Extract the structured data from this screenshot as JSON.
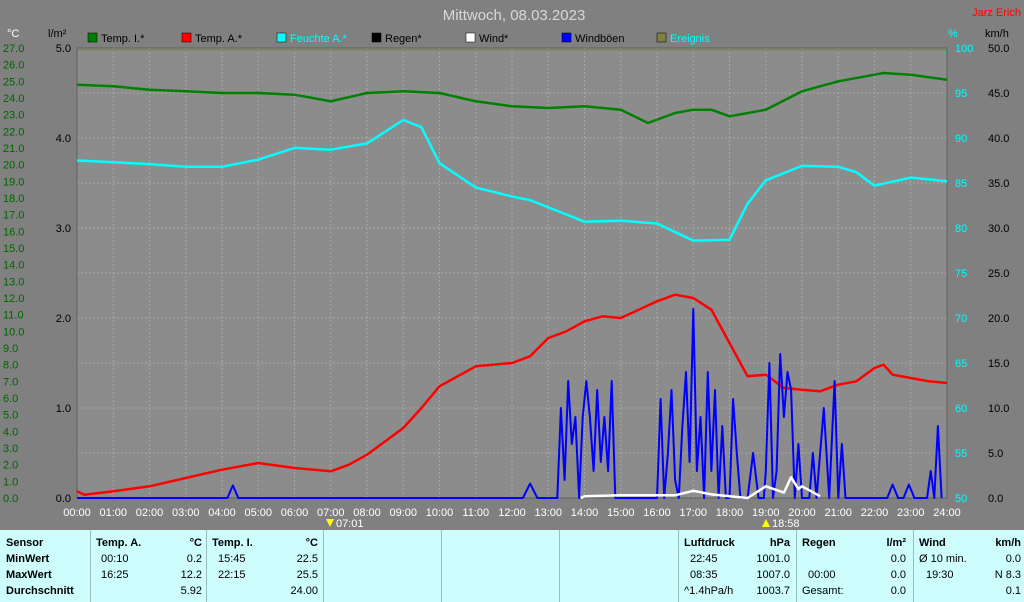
{
  "header": {
    "title": "Mittwoch, 08.03.2023",
    "author": "Jarz Erich"
  },
  "axes": {
    "left_unit_temp": "°C",
    "left_unit_rain": "l/m²",
    "right_unit_pct": "%",
    "right_unit_wind": "km/h"
  },
  "legend": [
    {
      "label": "Temp. I.*",
      "color": "#008000"
    },
    {
      "label": "Temp. A.*",
      "color": "#ff0000"
    },
    {
      "label": "Feuchte A.*",
      "color": "#00ffff"
    },
    {
      "label": "Regen*",
      "color": "#000000"
    },
    {
      "label": "Wind*",
      "color": "#ffffff"
    },
    {
      "label": "Windböen",
      "color": "#0000ff"
    },
    {
      "label": "Ereignis",
      "color": "#808040"
    }
  ],
  "markers": {
    "sunrise": "07:01",
    "sunset": "18:58"
  },
  "chart_data": {
    "type": "line",
    "title": "Mittwoch, 08.03.2023",
    "xlabels": [
      "00:00",
      "01:00",
      "02:00",
      "03:00",
      "04:00",
      "05:00",
      "06:00",
      "07:00",
      "08:00",
      "09:00",
      "10:00",
      "11:00",
      "12:00",
      "13:00",
      "14:00",
      "15:00",
      "16:00",
      "17:00",
      "18:00",
      "19:00",
      "20:00",
      "21:00",
      "22:00",
      "23:00",
      "24:00"
    ],
    "y_temp": {
      "range": [
        0,
        27
      ],
      "ticks": [
        "0.0",
        "1.0",
        "2.0",
        "3.0",
        "4.0",
        "5.0",
        "6.0",
        "7.0",
        "8.0",
        "9.0",
        "10.0",
        "11.0",
        "12.0",
        "13.0",
        "14.0",
        "15.0",
        "16.0",
        "17.0",
        "18.0",
        "19.0",
        "20.0",
        "21.0",
        "22.0",
        "23.0",
        "24.0",
        "25.0",
        "26.0",
        "27.0"
      ]
    },
    "y_rain": {
      "range": [
        0,
        5
      ],
      "ticks": [
        "0.0",
        "1.0",
        "2.0",
        "3.0",
        "4.0",
        "5.0"
      ]
    },
    "y_pct": {
      "range": [
        50,
        100
      ],
      "ticks": [
        "50",
        "55",
        "60",
        "65",
        "70",
        "75",
        "80",
        "85",
        "90",
        "95",
        "100"
      ]
    },
    "y_wind": {
      "range": [
        0,
        50
      ],
      "ticks": [
        "0.0",
        "5.0",
        "10.0",
        "15.0",
        "20.0",
        "25.0",
        "30.0",
        "35.0",
        "40.0",
        "45.0",
        "50.0"
      ]
    },
    "grid": true,
    "series": [
      {
        "name": "Temp. I.*",
        "axis": "temp",
        "color": "#008000",
        "x": [
          0,
          1,
          2,
          3,
          4,
          5,
          6,
          7,
          8,
          9,
          10,
          11,
          12,
          13,
          14,
          15,
          15.75,
          16.5,
          17,
          17.5,
          18,
          19,
          20,
          21,
          22,
          22.25,
          23,
          24
        ],
        "y": [
          24.8,
          24.7,
          24.5,
          24.4,
          24.3,
          24.3,
          24.2,
          23.8,
          24.3,
          24.4,
          24.3,
          23.8,
          23.5,
          23.4,
          23.5,
          23.3,
          22.5,
          23.1,
          23.3,
          23.3,
          22.9,
          23.3,
          24.4,
          25.0,
          25.4,
          25.5,
          25.4,
          25.1
        ]
      },
      {
        "name": "Temp. A.*",
        "axis": "temp",
        "color": "#ff0000",
        "x": [
          0,
          0.2,
          1,
          2,
          3,
          4,
          5,
          6,
          7,
          7.5,
          8,
          9,
          9.5,
          10,
          11,
          12,
          12.5,
          13,
          13.5,
          14,
          14.5,
          15,
          16,
          16.5,
          17,
          17.5,
          18,
          18.5,
          19,
          19.5,
          20,
          20.5,
          21,
          21.5,
          22,
          22.25,
          22.5,
          23,
          23.5,
          24
        ],
        "y": [
          0.4,
          0.2,
          0.4,
          0.7,
          1.2,
          1.7,
          2.1,
          1.8,
          1.6,
          2.0,
          2.6,
          4.2,
          5.4,
          6.7,
          7.9,
          8.1,
          8.5,
          9.6,
          10.0,
          10.6,
          10.9,
          10.8,
          11.8,
          12.2,
          12.0,
          11.3,
          9.3,
          7.3,
          7.4,
          6.6,
          6.5,
          6.4,
          6.8,
          7.0,
          7.8,
          8.0,
          7.4,
          7.2,
          7.0,
          6.9
        ]
      },
      {
        "name": "Feuchte A.*",
        "axis": "pct",
        "color": "#00ffff",
        "x": [
          0,
          1,
          2,
          3,
          4,
          5,
          6,
          7,
          8,
          9,
          9.5,
          10,
          11,
          12,
          12.5,
          13,
          14,
          15,
          16,
          17,
          18,
          18.5,
          19,
          20,
          21,
          21.5,
          22,
          23,
          24
        ],
        "y": [
          87.5,
          87.3,
          87.1,
          86.8,
          86.8,
          87.6,
          88.9,
          88.7,
          89.4,
          92.0,
          91.2,
          87.2,
          84.5,
          83.5,
          83.1,
          82.3,
          80.7,
          80.8,
          80.5,
          78.6,
          78.7,
          82.7,
          85.3,
          86.9,
          86.8,
          86.2,
          84.7,
          85.6,
          85.2
        ]
      },
      {
        "name": "Windböen",
        "axis": "wind",
        "color": "#0000ff",
        "x": [
          0,
          4.15,
          4.3,
          4.45,
          12.3,
          12.5,
          12.7,
          13.25,
          13.35,
          13.45,
          13.55,
          13.65,
          13.75,
          13.85,
          13.95,
          14.05,
          14.15,
          14.25,
          14.35,
          14.45,
          14.55,
          14.65,
          14.75,
          14.85,
          15.5,
          16.0,
          16.1,
          16.2,
          16.3,
          16.4,
          16.5,
          16.6,
          16.7,
          16.8,
          16.9,
          17.0,
          17.1,
          17.2,
          17.3,
          17.4,
          17.5,
          17.6,
          17.7,
          17.8,
          17.9,
          18.0,
          18.1,
          18.2,
          18.3,
          18.5,
          18.65,
          18.8,
          18.95,
          19.0,
          19.1,
          19.2,
          19.3,
          19.4,
          19.5,
          19.6,
          19.7,
          19.8,
          19.9,
          20.0,
          20.2,
          20.3,
          20.4,
          20.6,
          20.75,
          20.9,
          21.0,
          21.1,
          21.2,
          21.3,
          22.35,
          22.5,
          22.65,
          22.8,
          22.95,
          23.1,
          23.45,
          23.55,
          23.65,
          23.75,
          23.85
        ],
        "y": [
          0,
          0,
          1.4,
          0,
          0,
          1.6,
          0,
          0,
          10,
          2,
          13,
          6,
          9,
          0,
          9,
          13,
          9,
          3,
          12,
          4,
          9,
          3,
          13,
          0,
          0,
          0,
          11,
          0,
          5,
          12,
          2,
          0,
          8,
          14,
          4,
          21,
          3,
          9,
          0,
          14,
          3,
          12,
          0,
          8,
          0,
          0,
          11,
          5,
          0,
          0,
          5,
          0,
          0,
          3,
          15,
          0,
          3,
          16,
          9,
          14,
          12,
          0,
          6,
          0,
          0,
          5,
          0,
          10,
          0,
          13,
          0,
          6,
          0,
          0,
          0,
          1.5,
          0,
          0,
          1.5,
          0,
          0,
          3,
          0,
          8,
          0
        ]
      },
      {
        "name": "Wind*",
        "axis": "wind",
        "color": "#ffffff",
        "x": [
          13.9,
          14,
          15,
          16.5,
          17,
          17.5,
          18,
          18.5,
          19,
          19.5,
          19.7,
          19.9,
          20,
          20.5
        ],
        "y": [
          0,
          0.2,
          0.3,
          0.3,
          0.8,
          0.4,
          0.2,
          0,
          1.3,
          0.6,
          2.3,
          1.0,
          1.3,
          0.2
        ]
      },
      {
        "name": "Ereignis",
        "axis": "pct",
        "color": "#808040",
        "x": [
          0,
          24
        ],
        "y": [
          99.8,
          99.8
        ]
      }
    ]
  },
  "bottom": {
    "sensor": {
      "h": "Sensor",
      "r1": "MinWert",
      "r2": "MaxWert",
      "r3": "Durchschnitt"
    },
    "temp_a": {
      "h": "Temp. A.",
      "unit": "°C",
      "t1": "00:10",
      "v1": "0.2",
      "t2": "16:25",
      "v2": "12.2",
      "avg": "5.92"
    },
    "temp_i": {
      "h": "Temp. I.",
      "unit": "°C",
      "t1": "15:45",
      "v1": "22.5",
      "t2": "22:15",
      "v2": "25.5",
      "avg": "24.00"
    },
    "pressure": {
      "h": "Luftdruck",
      "unit": "hPa",
      "t1": "22:45",
      "v1": "1001.0",
      "t2": "08:35",
      "v2": "1007.0",
      "t3": "^1.4hPa/h",
      "v3": "1003.7"
    },
    "rain": {
      "h": "Regen",
      "unit": "l/m²",
      "t2": "00:00",
      "v1": "0.0",
      "v2": "0.0",
      "t3": "Gesamt:",
      "v3": "0.0"
    },
    "wind": {
      "h": "Wind",
      "unit": "km/h",
      "t1": "Ø 10 min.",
      "v1": "0.0",
      "t2": "19:30",
      "v2": "N 8.3",
      "v3": "0.1"
    }
  }
}
